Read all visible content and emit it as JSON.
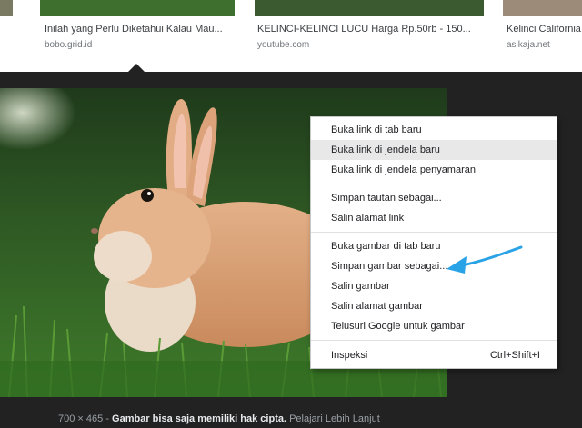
{
  "results": [
    {
      "title": "",
      "source": ""
    },
    {
      "title": "Inilah yang Perlu Diketahui Kalau Mau...",
      "source": "bobo.grid.id"
    },
    {
      "title": "KELINCI-KELINCI LUCU Harga Rp.50rb - 150...",
      "source": "youtube.com"
    },
    {
      "title": "Kelinci California",
      "source": "asikaja.net"
    }
  ],
  "context_menu": {
    "items": [
      {
        "label": "Buka link di tab baru"
      },
      {
        "label": "Buka link di jendela baru"
      },
      {
        "label": "Buka link di jendela penyamaran"
      },
      {
        "label": "Simpan tautan sebagai..."
      },
      {
        "label": "Salin alamat link"
      },
      {
        "label": "Buka gambar di tab baru"
      },
      {
        "label": "Simpan gambar sebagai..."
      },
      {
        "label": "Salin gambar"
      },
      {
        "label": "Salin alamat gambar"
      },
      {
        "label": "Telusuri Google untuk gambar"
      },
      {
        "label": "Inspeksi",
        "shortcut": "Ctrl+Shift+I"
      }
    ],
    "highlighted_item": "Buka link di jendela baru"
  },
  "image_info": {
    "dimensions": "700 × 465",
    "separator": "-",
    "copyright_notice": "Gambar bisa saja memiliki hak cipta.",
    "learn_more": "Pelajari Lebih Lanjut"
  },
  "colors": {
    "annotation_arrow": "#2aa3e6",
    "background": "#222222"
  }
}
